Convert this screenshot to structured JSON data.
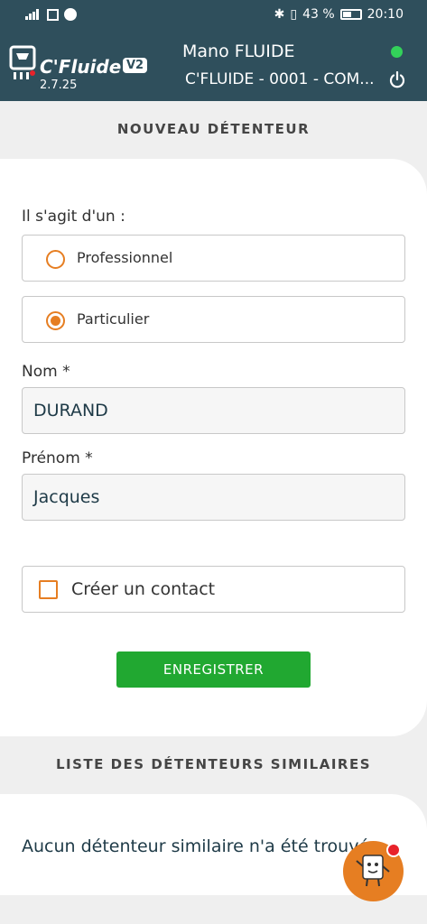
{
  "status_bar": {
    "battery": "43 %",
    "time": "20:10"
  },
  "app_bar": {
    "brand": "C'Fluide",
    "brand_badge": "V2",
    "version": "2.7.25",
    "device_name": "Mano FLUIDE",
    "site_name": "C'FLUIDE - 0001 - COM...",
    "connection_color": "#33d15a"
  },
  "form": {
    "section_title": "NOUVEAU DÉTENTEUR",
    "type_question": "Il s'agit d'un :",
    "options": [
      {
        "label": "Professionnel",
        "selected": false
      },
      {
        "label": "Particulier",
        "selected": true
      }
    ],
    "nom_label": "Nom *",
    "nom_value": "DURAND",
    "prenom_label": "Prénom *",
    "prenom_value": "Jacques",
    "create_contact_label": "Créer un contact",
    "save_label": "ENREGISTRER"
  },
  "similar": {
    "section_title": "LISTE DES DÉTENTEURS SIMILAIRES",
    "empty_message": "Aucun détenteur similaire n'a été trouvé"
  },
  "colors": {
    "header": "#2f4f5c",
    "accent": "#e67e22",
    "save_button": "#21a831"
  }
}
